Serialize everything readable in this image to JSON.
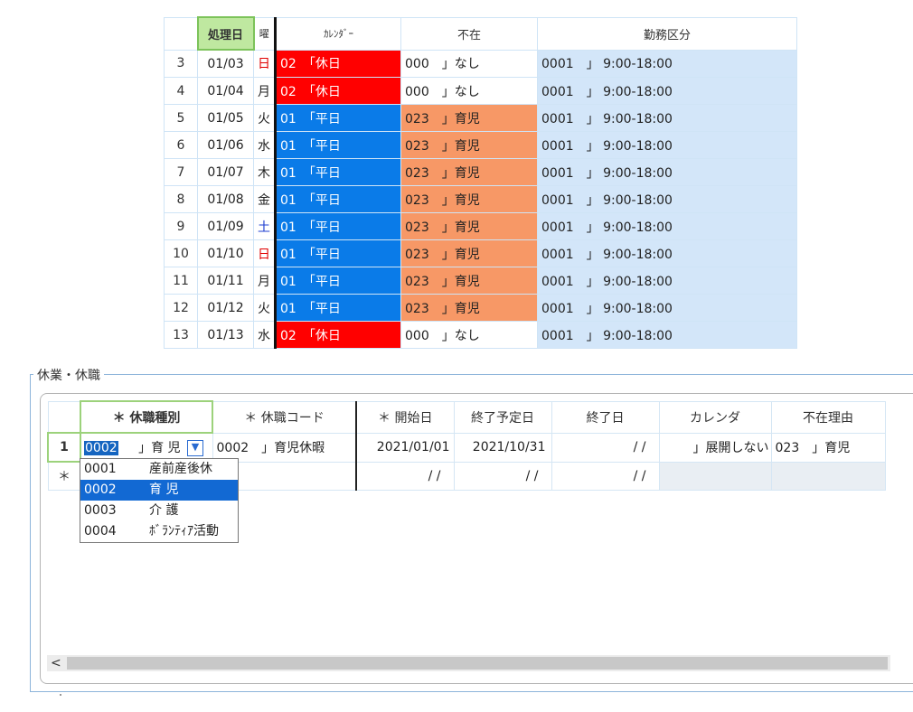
{
  "calendar_grid": {
    "headers": [
      "",
      "処理日",
      "曜",
      "ｶﾚﾝﾀﾞｰ",
      "不在",
      "勤務区分"
    ],
    "rows": [
      {
        "no": "3",
        "date": "01/03",
        "wd": "日",
        "wd_color": "red",
        "cal": "02　「休日",
        "cal_type": "holiday",
        "absence": "000　」なし",
        "abs_type": "none",
        "work": "0001　」 9:00-18:00"
      },
      {
        "no": "4",
        "date": "01/04",
        "wd": "月",
        "wd_color": "",
        "cal": "02　「休日",
        "cal_type": "holiday",
        "absence": "000　」なし",
        "abs_type": "none",
        "work": "0001　」 9:00-18:00"
      },
      {
        "no": "5",
        "date": "01/05",
        "wd": "火",
        "wd_color": "",
        "cal": "01　「平日",
        "cal_type": "weekday",
        "absence": "023　」育児",
        "abs_type": "childcare",
        "work": "0001　」 9:00-18:00"
      },
      {
        "no": "6",
        "date": "01/06",
        "wd": "水",
        "wd_color": "",
        "cal": "01　「平日",
        "cal_type": "weekday",
        "absence": "023　」育児",
        "abs_type": "childcare",
        "work": "0001　」 9:00-18:00"
      },
      {
        "no": "7",
        "date": "01/07",
        "wd": "木",
        "wd_color": "",
        "cal": "01　「平日",
        "cal_type": "weekday",
        "absence": "023　」育児",
        "abs_type": "childcare",
        "work": "0001　」 9:00-18:00"
      },
      {
        "no": "8",
        "date": "01/08",
        "wd": "金",
        "wd_color": "",
        "cal": "01　「平日",
        "cal_type": "weekday",
        "absence": "023　」育児",
        "abs_type": "childcare",
        "work": "0001　」 9:00-18:00"
      },
      {
        "no": "9",
        "date": "01/09",
        "wd": "土",
        "wd_color": "blue",
        "cal": "01　「平日",
        "cal_type": "weekday",
        "absence": "023　」育児",
        "abs_type": "childcare",
        "work": "0001　」 9:00-18:00"
      },
      {
        "no": "10",
        "date": "01/10",
        "wd": "日",
        "wd_color": "red",
        "cal": "01　「平日",
        "cal_type": "weekday",
        "absence": "023　」育児",
        "abs_type": "childcare",
        "work": "0001　」 9:00-18:00"
      },
      {
        "no": "11",
        "date": "01/11",
        "wd": "月",
        "wd_color": "",
        "cal": "01　「平日",
        "cal_type": "weekday",
        "absence": "023　」育児",
        "abs_type": "childcare",
        "work": "0001　」 9:00-18:00"
      },
      {
        "no": "12",
        "date": "01/12",
        "wd": "火",
        "wd_color": "",
        "cal": "01　「平日",
        "cal_type": "weekday",
        "absence": "023　」育児",
        "abs_type": "childcare",
        "work": "0001　」 9:00-18:00"
      },
      {
        "no": "13",
        "date": "01/13",
        "wd": "水",
        "wd_color": "",
        "cal": "02　「休日",
        "cal_type": "holiday",
        "absence": "000　」なし",
        "abs_type": "none",
        "work": "0001　」 9:00-18:00"
      }
    ]
  },
  "leave_section": {
    "title": "休業・休職",
    "headers": [
      "",
      "＊ 休職種別",
      "＊ 休職コード",
      "＊ 開始日",
      "終了予定日",
      "終了日",
      "カレンダ",
      "不在理由"
    ],
    "row1": {
      "row_header": "1",
      "type_code": "0002",
      "type_name": "」育 児",
      "leave_code": "0002　」育児休暇",
      "start": "2021/01/01",
      "planned_end": "2021/10/31",
      "end": "/ /",
      "calendar": "」展開しない",
      "reason": "023　」育児"
    },
    "new_row": {
      "row_header": "＊",
      "start": "/ /",
      "planned_end": "/ /",
      "end": "/ /"
    },
    "dropdown_options": [
      {
        "code": "0001",
        "name": "産前産後休"
      },
      {
        "code": "0002",
        "name": "育 児"
      },
      {
        "code": "0003",
        "name": "介 護"
      },
      {
        "code": "0004",
        "name": "ﾎﾞﾗﾝﾃｨｱ活動"
      }
    ],
    "selected_option": "0002"
  },
  "colors": {
    "holiday": "#ff0000",
    "weekday": "#0a7be8",
    "childcare": "#f79866",
    "work_bg": "#d3e6f9",
    "header_highlight": "#bfe8a0"
  }
}
